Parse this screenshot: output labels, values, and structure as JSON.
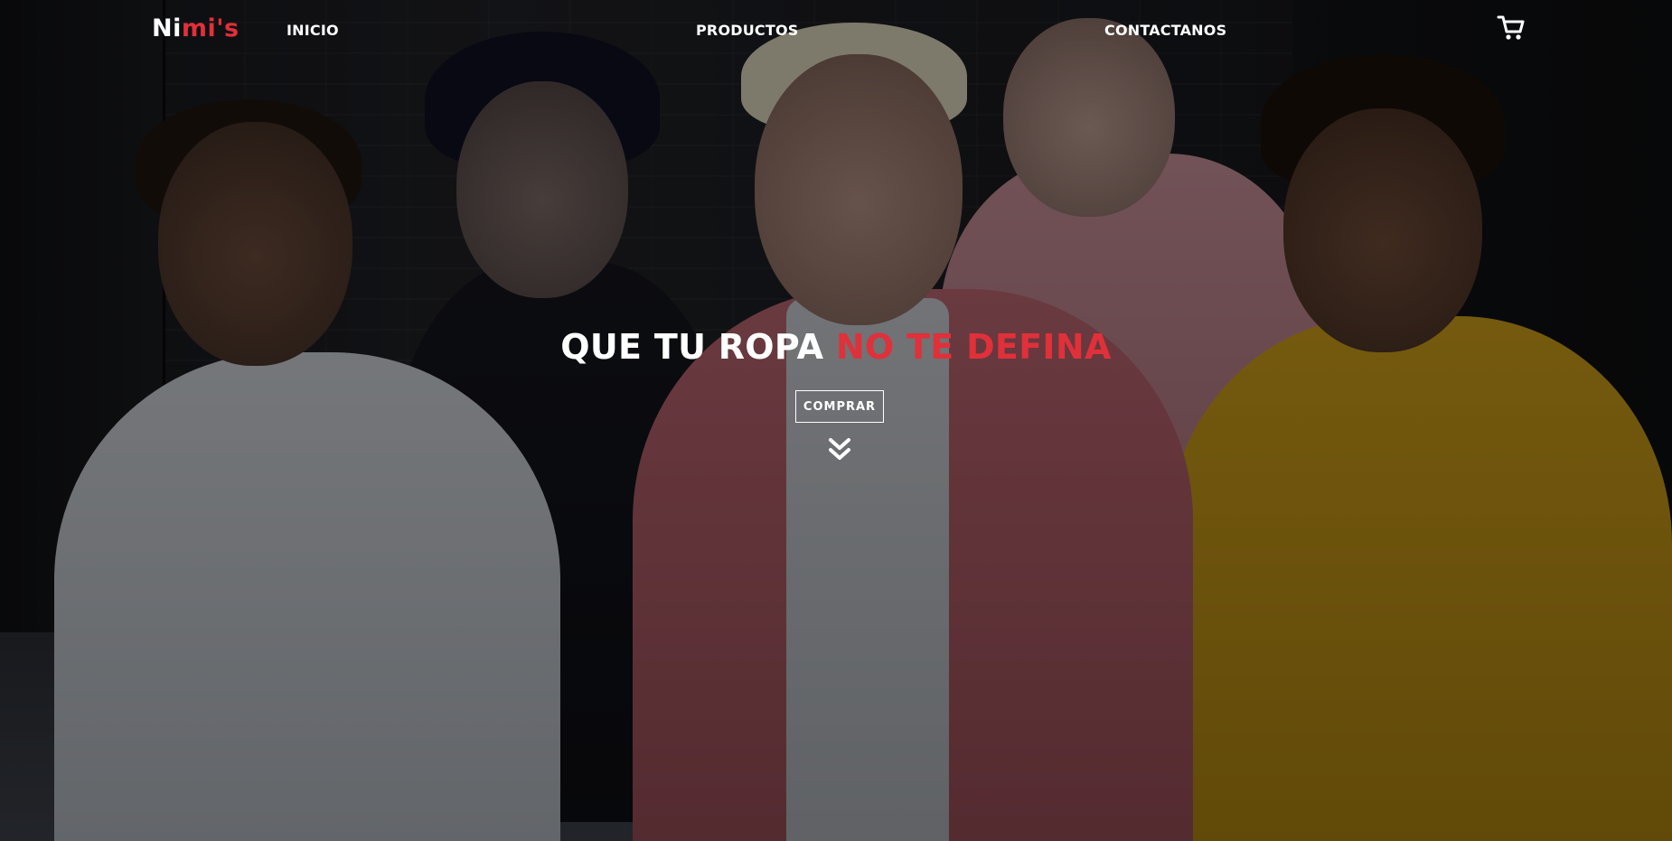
{
  "brand": {
    "logo_main": "Ni",
    "logo_accent": "mi's",
    "accent_color": "#e0303a"
  },
  "nav": {
    "items": [
      {
        "label": "INICIO"
      },
      {
        "label": "PRODUCTOS"
      },
      {
        "label": "CONTACTANOS"
      }
    ],
    "cart_icon": "shopping-cart-icon"
  },
  "hero": {
    "headline_main": "QUE TU ROPA ",
    "headline_accent": "NO TE DEFINA",
    "cta_label": "COMPRAR",
    "scroll_icon": "double-chevron-down-icon"
  }
}
